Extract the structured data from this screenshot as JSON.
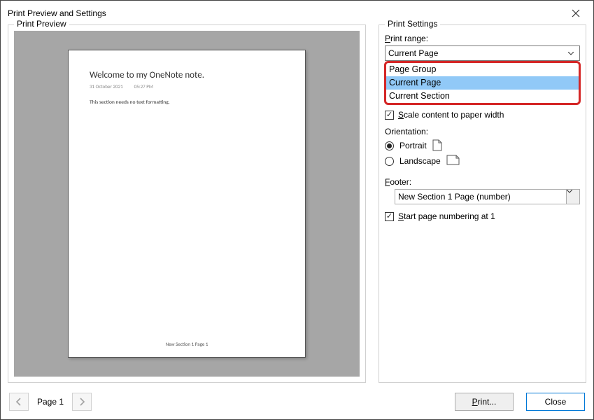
{
  "window": {
    "title": "Print Preview and Settings"
  },
  "preview": {
    "groupLabel": "Print Preview",
    "page": {
      "title": "Welcome to my OneNote note.",
      "date": "31 October 2021",
      "time": "05:27 PM",
      "body": "This section needs no text formatting.",
      "footer": "New Section 1 Page 1"
    }
  },
  "settings": {
    "groupLabel": "Print Settings",
    "printRangeLabel": "Print range:",
    "printRangeSelected": "Current Page",
    "printRangeOptions": [
      "Page Group",
      "Current Page",
      "Current Section"
    ],
    "scaleLabel": "Scale content to paper width",
    "scaleChecked": true,
    "orientationLabel": "Orientation:",
    "portraitLabel": "Portrait",
    "landscapeLabel": "Landscape",
    "orientationValue": "Portrait",
    "footerLabel": "Footer:",
    "footerSelected": "New Section 1 Page (number)",
    "startNumLabel": "Start page numbering at 1",
    "startNumChecked": true
  },
  "nav": {
    "pageIndicator": "Page 1"
  },
  "buttons": {
    "print": "Print...",
    "close": "Close"
  }
}
